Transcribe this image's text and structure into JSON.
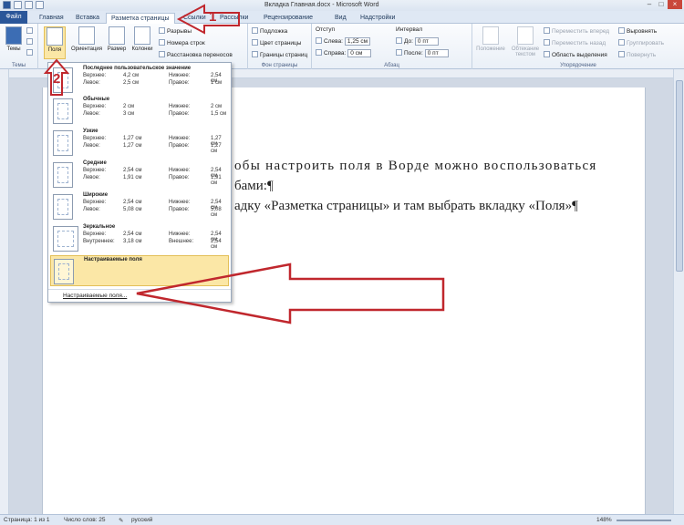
{
  "window": {
    "title": "Вкладка Главная.docx - Microsoft Word"
  },
  "tabs": [
    "Файл",
    "Главная",
    "Вставка",
    "Разметка страницы",
    "Ссылки",
    "Рассылки",
    "Рецензирование",
    "Вид",
    "Надстройки"
  ],
  "ribbon": {
    "themes": {
      "button": "Темы",
      "group": "Темы"
    },
    "page_setup": {
      "margins": "Поля",
      "orientation": "Ориентация",
      "size": "Размер",
      "columns": "Колонки",
      "breaks": "Разрывы",
      "line_numbers": "Номера строк",
      "hyphenation": "Расстановка переносов"
    },
    "page_background": {
      "watermark": "Подложка",
      "page_color": "Цвет страницы",
      "page_borders": "Границы страниц",
      "group": "Фон страницы"
    },
    "paragraph": {
      "indent": "Отступ",
      "spacing": "Интервал",
      "left_label": "Слева:",
      "left_value": "1,25 см",
      "right_label": "Справа:",
      "right_value": "0 см",
      "before_label": "До:",
      "before_value": "0 пт",
      "after_label": "После:",
      "after_value": "0 пт",
      "group": "Абзац"
    },
    "arrange": {
      "position": "Положение",
      "wrap": "Обтекание текстом",
      "bring_forward": "Переместить вперед",
      "send_backward": "Переместить назад",
      "selection_pane": "Область выделения",
      "align": "Выровнять",
      "group_btn": "Группировать",
      "rotate": "Повернуть",
      "group": "Упорядочение"
    }
  },
  "margins_menu": {
    "items": [
      {
        "name": "Последнее пользовательское значение",
        "top_label": "Верхнее:",
        "top": "4,2 см",
        "bottom_label": "Нижнее:",
        "bottom": "2,54 см",
        "left_label": "Левое:",
        "left": "2,5 см",
        "right_label": "Правое:",
        "right": "1 см"
      },
      {
        "name": "Обычные",
        "top_label": "Верхнее:",
        "top": "2 см",
        "bottom_label": "Нижнее:",
        "bottom": "2 см",
        "left_label": "Левое:",
        "left": "3 см",
        "right_label": "Правое:",
        "right": "1,5 см"
      },
      {
        "name": "Узкие",
        "top_label": "Верхнее:",
        "top": "1,27 см",
        "bottom_label": "Нижнее:",
        "bottom": "1,27 см",
        "left_label": "Левое:",
        "left": "1,27 см",
        "right_label": "Правое:",
        "right": "1,27 см"
      },
      {
        "name": "Средние",
        "top_label": "Верхнее:",
        "top": "2,54 см",
        "bottom_label": "Нижнее:",
        "bottom": "2,54 см",
        "left_label": "Левое:",
        "left": "1,91 см",
        "right_label": "Правое:",
        "right": "1,91 см"
      },
      {
        "name": "Широкие",
        "top_label": "Верхнее:",
        "top": "2,54 см",
        "bottom_label": "Нижнее:",
        "bottom": "2,54 см",
        "left_label": "Левое:",
        "left": "5,08 см",
        "right_label": "Правое:",
        "right": "5,08 см"
      },
      {
        "name": "Зеркальное",
        "top_label": "Верхнее:",
        "top": "2,54 см",
        "bottom_label": "Нижнее:",
        "bottom": "2,54 см",
        "left_label": "Внутреннее:",
        "left": "3,18 см",
        "right_label": "Внешнее:",
        "right": "2,54 см"
      }
    ],
    "custom_item": "Настраиваемые поля",
    "custom_link": "Настраиваемые поля..."
  },
  "document": {
    "line1": "обы настроить поля в Ворде можно воспользоваться",
    "line2": "бами:¶",
    "line3": "адку «Разметка страницы» и там выбрать вкладку «Поля»¶"
  },
  "annotations": {
    "label1": "1",
    "label2": "2",
    "color": "#c0272d"
  },
  "status": {
    "page": "Страница: 1 из 1",
    "words": "Число слов: 25",
    "language": "русский",
    "zoom": "148%"
  }
}
